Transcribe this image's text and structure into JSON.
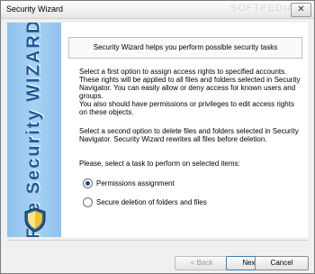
{
  "window": {
    "title": "Security Wizard",
    "watermark": "SOFTPEDIA",
    "close_glyph": "✕"
  },
  "side_panel": {
    "title": "File Security WIZARD",
    "icon": "shield-icon"
  },
  "main": {
    "header": "Security Wizard helps you perform possible security tasks",
    "para1": "Select a first option to assign access rights to specified accounts. These rights will be applied to all files and folders selected in Security Navigator. You can easily allow or deny access for known users and groups.",
    "para1b": "You also should have permissions or privileges to edit access rights on these objects.",
    "para2": "Select a second option to delete files and folders selected in Security Navigator. Security Wizard rewrites all files before deletion.",
    "prompt": "Please, select a task to perform on selected items:",
    "options": [
      {
        "label": "Permissions assignment",
        "checked": true
      },
      {
        "label": "Secure deletion of folders and files",
        "checked": false
      }
    ]
  },
  "buttons": {
    "back": "< Back",
    "next": "Next >",
    "cancel": "Cancel"
  }
}
